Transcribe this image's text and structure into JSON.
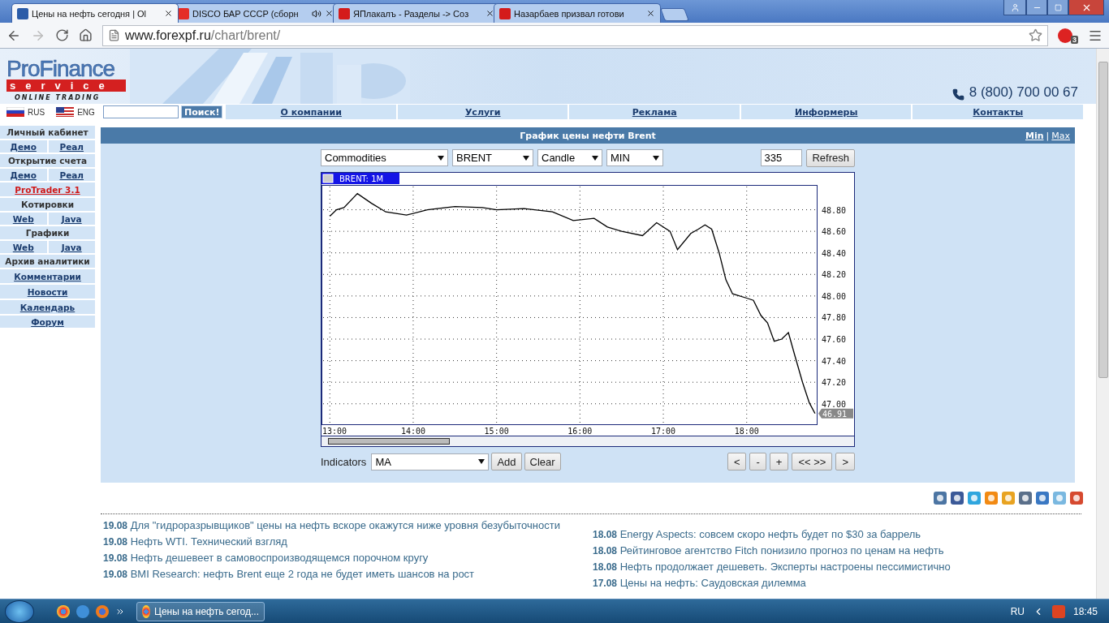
{
  "browser": {
    "tabs": [
      {
        "title": "Цены на нефть сегодня | Ol",
        "selected": true
      },
      {
        "title": "DISCO БАР СССР (сборн",
        "selected": false
      },
      {
        "title": "ЯПлакалъ - Разделы -> Coз",
        "selected": false
      },
      {
        "title": "Назарбаев призвал готови",
        "selected": false
      }
    ],
    "url": {
      "domain": "www.forexpf.ru",
      "path": "/chart/brent/"
    },
    "extension_badge": "3"
  },
  "header": {
    "logo": {
      "name": "ProFinance",
      "sub": "service",
      "tagline": "ONLINE TRADING"
    },
    "phone": "8 (800) 700 00 67"
  },
  "languages": [
    {
      "label": "RUS"
    },
    {
      "label": "ENG"
    }
  ],
  "search": {
    "button": "Поиск!"
  },
  "nav": [
    "О компании",
    "Услуги",
    "Реклама",
    "Информеры",
    "Контакты"
  ],
  "sidebar": [
    {
      "kind": "heading",
      "text": "Личный кабинет"
    },
    {
      "kind": "pair",
      "links": [
        "Демо",
        "Реал"
      ]
    },
    {
      "kind": "heading",
      "text": "Открытие счета"
    },
    {
      "kind": "pair",
      "links": [
        "Демо",
        "Реал"
      ]
    },
    {
      "kind": "promo",
      "text": "ProTrader 3.1"
    },
    {
      "kind": "heading",
      "text": "Котировки"
    },
    {
      "kind": "pair",
      "links": [
        "Web",
        "Java"
      ]
    },
    {
      "kind": "heading",
      "text": "Графики"
    },
    {
      "kind": "pair",
      "links": [
        "Web",
        "Java"
      ]
    },
    {
      "kind": "heading",
      "text": "Архив аналитики"
    },
    {
      "kind": "link",
      "text": "Комментарии"
    },
    {
      "kind": "link",
      "text": "Новости"
    },
    {
      "kind": "link",
      "text": "Календарь"
    },
    {
      "kind": "link",
      "text": "Форум"
    }
  ],
  "panel": {
    "title": "График цены нефти Brent",
    "size_separator": "|",
    "size_links": [
      {
        "label": "Min",
        "selected": true
      },
      {
        "label": "Max",
        "selected": false
      }
    ],
    "selects": [
      "Commodities",
      "BRENT",
      "Candle",
      "MIN"
    ],
    "count": "335",
    "refresh": "Refresh",
    "chart": {
      "legend": "BRENT: 1M",
      "last_price": "46.91",
      "chart_data": {
        "type": "line",
        "x": [
          13,
          13.08,
          13.17,
          13.33,
          13.5,
          13.67,
          13.92,
          14.17,
          14.5,
          14.83,
          15,
          15.33,
          15.67,
          15.92,
          16.17,
          16.33,
          16.5,
          16.75,
          16.92,
          17.08,
          17.17,
          17.33,
          17.42,
          17.5,
          17.58,
          17.67,
          17.75,
          17.83,
          18,
          18.08,
          18.17,
          18.25,
          18.33,
          18.42,
          18.5,
          18.58,
          18.67,
          18.75,
          18.82
        ],
        "series": [
          {
            "color": "#000000",
            "values": [
              48.74,
              48.8,
              48.82,
              48.95,
              48.86,
              48.78,
              48.75,
              48.8,
              48.83,
              48.82,
              48.8,
              48.81,
              48.78,
              48.7,
              48.72,
              48.64,
              48.6,
              48.56,
              48.68,
              48.6,
              48.43,
              48.58,
              48.62,
              48.66,
              48.62,
              48.4,
              48.15,
              48.02,
              47.98,
              47.96,
              47.82,
              47.75,
              47.58,
              47.6,
              47.66,
              47.44,
              47.2,
              47.01,
              46.91
            ]
          }
        ],
        "grid": true,
        "xlim": [
          12.9,
          18.84
        ],
        "ylim": [
          46.81,
          49.03
        ],
        "xticks": [
          {
            "value": 13,
            "label": "13:00"
          },
          {
            "value": 14,
            "label": "14:00"
          },
          {
            "value": 15,
            "label": "15:00"
          },
          {
            "value": 16,
            "label": "16:00"
          },
          {
            "value": 17,
            "label": "17:00"
          },
          {
            "value": 18,
            "label": "18:00"
          }
        ],
        "yticks": [
          {
            "value": 47,
            "label": "47.00"
          },
          {
            "value": 47.2,
            "label": "47.20"
          },
          {
            "value": 47.4,
            "label": "47.40"
          },
          {
            "value": 47.6,
            "label": "47.60"
          },
          {
            "value": 47.8,
            "label": "47.80"
          },
          {
            "value": 48,
            "label": "48.00"
          },
          {
            "value": 48.2,
            "label": "48.20"
          },
          {
            "value": 48.4,
            "label": "48.40"
          },
          {
            "value": 48.6,
            "label": "48.60"
          },
          {
            "value": 48.8,
            "label": "48.80"
          }
        ]
      }
    },
    "indicators": {
      "label": "Indicators",
      "select": "MA",
      "buttons": [
        "Add",
        "Clear"
      ]
    },
    "nav_buttons": [
      "<",
      "-",
      "+",
      "<< >>",
      ">"
    ]
  },
  "news": {
    "left": [
      {
        "date": "19.08",
        "title": "Для \"гидроразрывщиков\" цены на нефть вскоре окажутся ниже уровня безубыточности"
      },
      {
        "date": "19.08",
        "title": "Нефть WTI. Технический взгляд"
      },
      {
        "date": "19.08",
        "title": "Нефть дешевеет в самовоспроизводящемся порочном кругу"
      },
      {
        "date": "19.08",
        "title": "BMI Research: нефть Brent еще 2 года не будет иметь шансов на рост"
      }
    ],
    "right": [
      {
        "date": "18.08",
        "title": "Energy Aspects: совсем скоро нефть будет по $30 за баррель"
      },
      {
        "date": "18.08",
        "title": "Рейтинговое агентство Fitch понизило прогноз по ценам на нефть"
      },
      {
        "date": "18.08",
        "title": "Нефть продолжает дешеветь. Эксперты настроены пессимистично"
      },
      {
        "date": "17.08",
        "title": "Цены на нефть: Саудовская дилемма"
      }
    ]
  },
  "taskbar": {
    "window": "Цены на нефть сегод...",
    "language": "RU",
    "time": "18:45"
  }
}
